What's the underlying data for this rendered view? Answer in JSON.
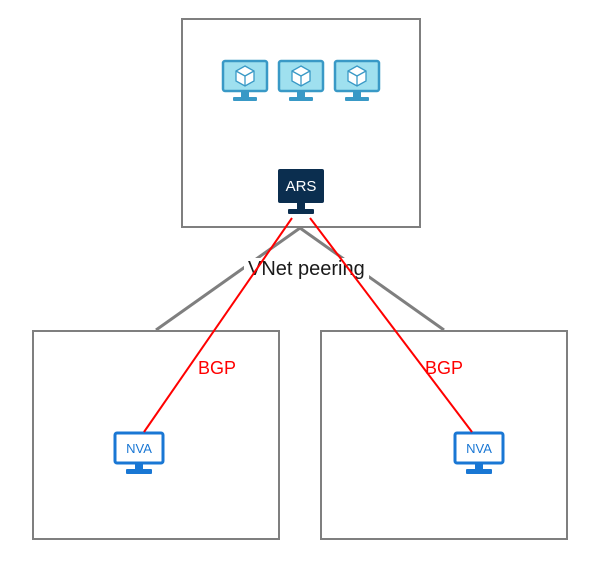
{
  "labels": {
    "peering": "VNet peering",
    "bgp_left": "BGP",
    "bgp_right": "BGP",
    "ars": "ARS",
    "nva_left": "NVA",
    "nva_right": "NVA"
  },
  "colors": {
    "box_border": "#7f7f7f",
    "peer_line": "#7f7f7f",
    "bgp_line": "#ff0000",
    "vm_blue_fill": "#9fe0ef",
    "vm_blue_stroke": "#3999c6",
    "ars_fill": "#0b2e4f",
    "ars_text": "#ffffff",
    "nva_stroke": "#1977d4",
    "nva_text": "#1977d4"
  },
  "icons": {
    "vm_count": 3,
    "ars": "ars-server-icon",
    "nva": "nva-server-icon",
    "vm": "vm-monitor-icon"
  },
  "diagram": {
    "top_box": "hub-vnet",
    "left_box": "spoke-vnet-left",
    "right_box": "spoke-vnet-right"
  }
}
